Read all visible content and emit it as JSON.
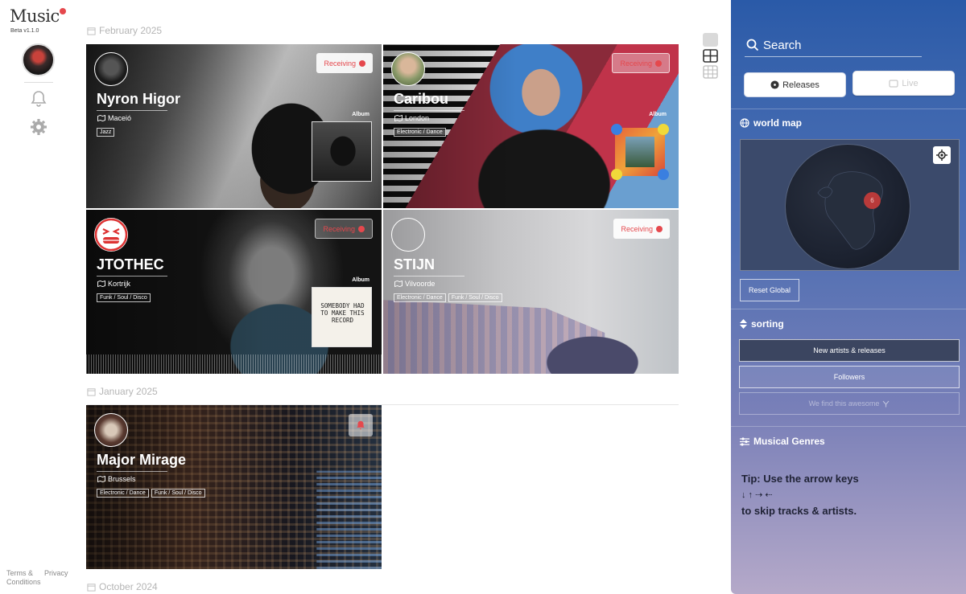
{
  "app": {
    "logo": "Music",
    "version": "Beta v1.1.0",
    "footer_terms": "Terms &",
    "footer_conditions": "Conditions",
    "footer_privacy": "Privacy"
  },
  "feed": {
    "sections": [
      {
        "date": "February 2025"
      },
      {
        "date": "January 2025"
      },
      {
        "date": "October 2024"
      }
    ],
    "cards": [
      {
        "name": "Nyron Higor",
        "city": "Maceió",
        "genres": [
          "Jazz"
        ],
        "status": "Receiving",
        "album_label": "Album"
      },
      {
        "name": "Caribou",
        "city": "London",
        "genres": [
          "Electronic / Dance"
        ],
        "status": "Receiving",
        "album_label": "Album"
      },
      {
        "name": "JTOTHEC",
        "city": "Kortrijk",
        "genres": [
          "Funk / Soul / Disco"
        ],
        "status": "Receiving",
        "album_label": "Album",
        "cover_text": "SOMEBODY HAD TO MAKE THIS RECORD"
      },
      {
        "name": "STIJN",
        "city": "Vilvoorde",
        "genres": [
          "Electronic / Dance",
          "Funk / Soul / Disco"
        ],
        "status": "Receiving"
      },
      {
        "name": "Major Mirage",
        "city": "Brussels",
        "genres": [
          "Electronic / Dance",
          "Funk / Soul / Disco"
        ]
      }
    ]
  },
  "panel": {
    "search_placeholder": "Search",
    "tabs": {
      "releases": "Releases",
      "live": "Live"
    },
    "world_map": {
      "title": "world map",
      "cluster_count": "6",
      "reset": "Reset Global"
    },
    "sorting": {
      "title": "sorting",
      "options": [
        "New artists & releases",
        "Followers",
        "We find this awesome"
      ],
      "selected": "New artists & releases"
    },
    "genres_title": "Musical Genres",
    "tip": {
      "line1": "Tip: Use the arrow keys",
      "arrows": "↓ ↑ ⇢ ⇠",
      "line2": "to skip tracks & artists."
    }
  },
  "colors": {
    "accent": "#e5484d",
    "panel_top": "#2a5aa8",
    "panel_bottom": "#b5a9c9"
  }
}
